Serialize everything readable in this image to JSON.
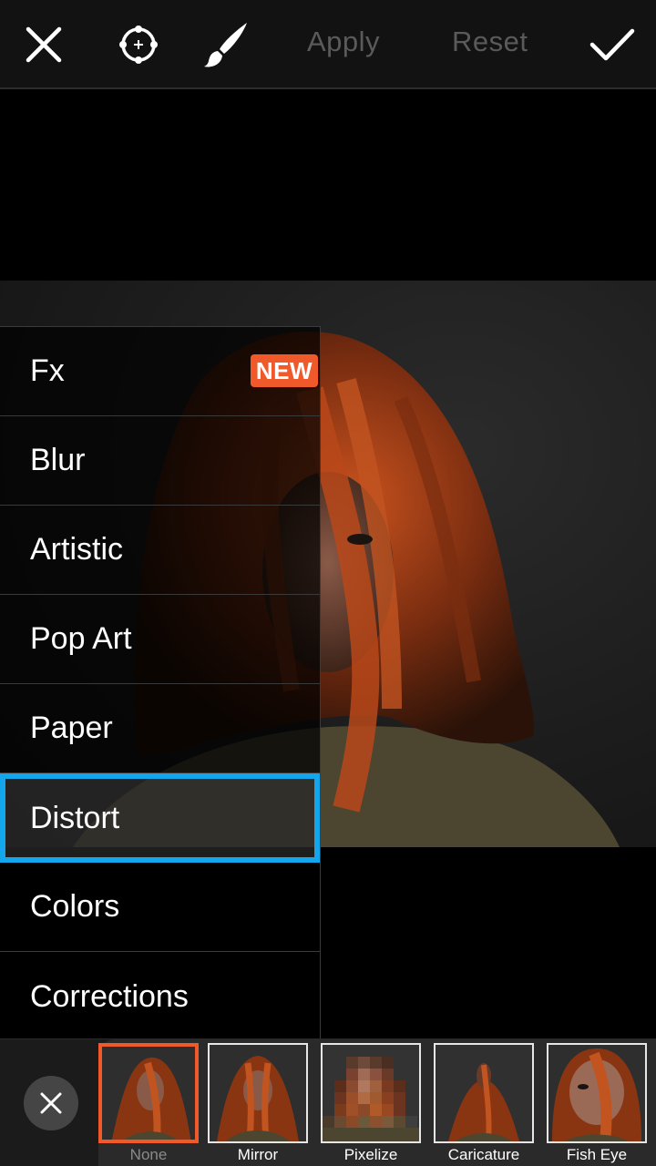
{
  "toolbar": {
    "close_icon": "close-icon",
    "target_icon": "crosshair-target-icon",
    "brush_icon": "brush-icon",
    "apply_label": "Apply",
    "reset_label": "Reset",
    "confirm_icon": "checkmark-icon"
  },
  "menu": {
    "items": [
      {
        "label": "Fx",
        "badge": "NEW"
      },
      {
        "label": "Blur"
      },
      {
        "label": "Artistic"
      },
      {
        "label": "Pop Art"
      },
      {
        "label": "Paper"
      },
      {
        "label": "Distort"
      },
      {
        "label": "Colors"
      },
      {
        "label": "Corrections"
      }
    ],
    "selected": "Distort"
  },
  "effects": {
    "close_icon": "close-icon",
    "items": [
      {
        "label": "None",
        "active": true
      },
      {
        "label": "Mirror"
      },
      {
        "label": "Pixelize"
      },
      {
        "label": "Caricature"
      },
      {
        "label": "Fish Eye"
      }
    ]
  },
  "colors": {
    "accent_selected": "#14a6ec",
    "badge": "#f05a2b",
    "active_thumb_border": "#f05a2b",
    "disabled_text": "#5a5a5a"
  }
}
